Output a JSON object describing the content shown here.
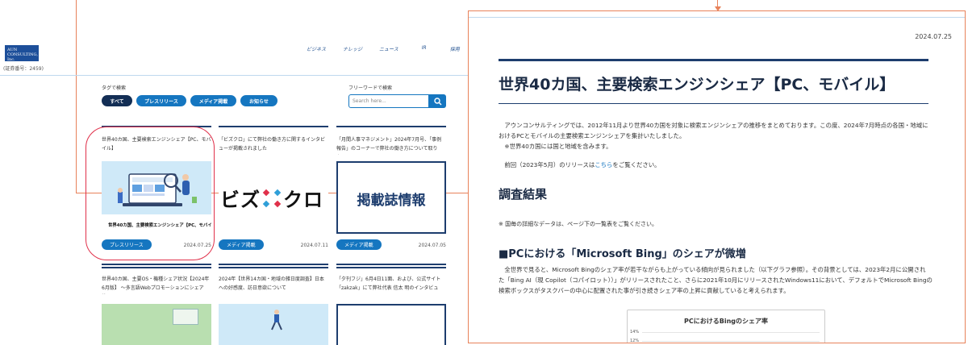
{
  "site": {
    "logo_text": "AUN CONSULTING, Inc.",
    "reg_no": "(証券番号：2459)",
    "nav": [
      "ビジネス",
      "ナレッジ",
      "ニュース",
      "IR",
      "採用"
    ],
    "tag_label": "タグで検索",
    "tags": [
      "すべて",
      "プレスリリース",
      "メディア掲載",
      "お知らせ"
    ],
    "keyword_label": "フリーワードで検索",
    "search_placeholder": "Search here..."
  },
  "cards": [
    {
      "title": "世界40カ国、主要検索エンジンシェア【PC、モバイル】",
      "thumb_caption": "世界40カ国、主要検索エンジンシェア【PC、モバイル】",
      "badge": "プレスリリース",
      "date": "2024.07.25"
    },
    {
      "title": "「ビズクロ」にて弊社の働き方に関するインタビューが掲載されました",
      "thumb_word_a": "ビズ",
      "thumb_word_b": "クロ",
      "badge": "メディア掲載",
      "date": "2024.07.11"
    },
    {
      "title": "「月間人事マネジメント」2024年7月号、「事例報告」のコーナーで弊社の働き方について取り上…",
      "thumb_text": "掲載誌情報",
      "badge": "メディア掲載",
      "date": "2024.07.05"
    },
    {
      "title": "世界40カ国、主要OS・機種シェア状況【2024年6月版】 ～多言語Webプロモーションにシェア状…"
    },
    {
      "title": "2024年【世界14カ国・地域の雑日度調査】日本への好感度、訪日意欲について"
    },
    {
      "title": "「夕刊フジ」6月4日11面、および、公式サイト「zakzak」にて弊社代表 信太 明のインタビュー…"
    }
  ],
  "article": {
    "date": "2024.07.25",
    "title": "世界40カ国、主要検索エンジンシェア【PC、モバイル】",
    "intro_1": "　アウンコンサルティングでは、2012年11月より世界40カ国を対象に検索エンジンシェアの推移をまとめております。この度、2024年7月時点の各国・地域に",
    "intro_2": "おけるPCとモバイルの主要検索エンジンシェアを集計いたしました。",
    "intro_3": "　※世界40カ国には国と地域を含みます。",
    "prev_before": "　前回（2023年5月）のリリースは",
    "prev_link": "こちら",
    "prev_after": "をご覧ください。",
    "h2": "調査結果",
    "note": "※ 国毎の詳細なデータは、ページ下の一覧表をご覧ください。",
    "h3": "■PCにおける「Microsoft Bing」のシェアが微増",
    "body_1": "　全世界で見ると、Microsoft Bingのシェア率が若干ながらも上がっている傾向が見られました（以下グラフ参照）。その背景としては、2023年2月に公開され",
    "body_2": "た「Bing AI（現 Copilot（コパイロット））」がリリースされたこと、さらに2021年10月にリリースされたWindows11において、デフォルトでMicrosoft Bingの",
    "body_3": "検索ボックスがタスクバーの中心に配置された事が引き続きシェア率の上昇に貢献していると考えられます。",
    "chart_title": "PCにおけるBingのシェア率",
    "chart_ticks": [
      "14%",
      "12%"
    ]
  }
}
